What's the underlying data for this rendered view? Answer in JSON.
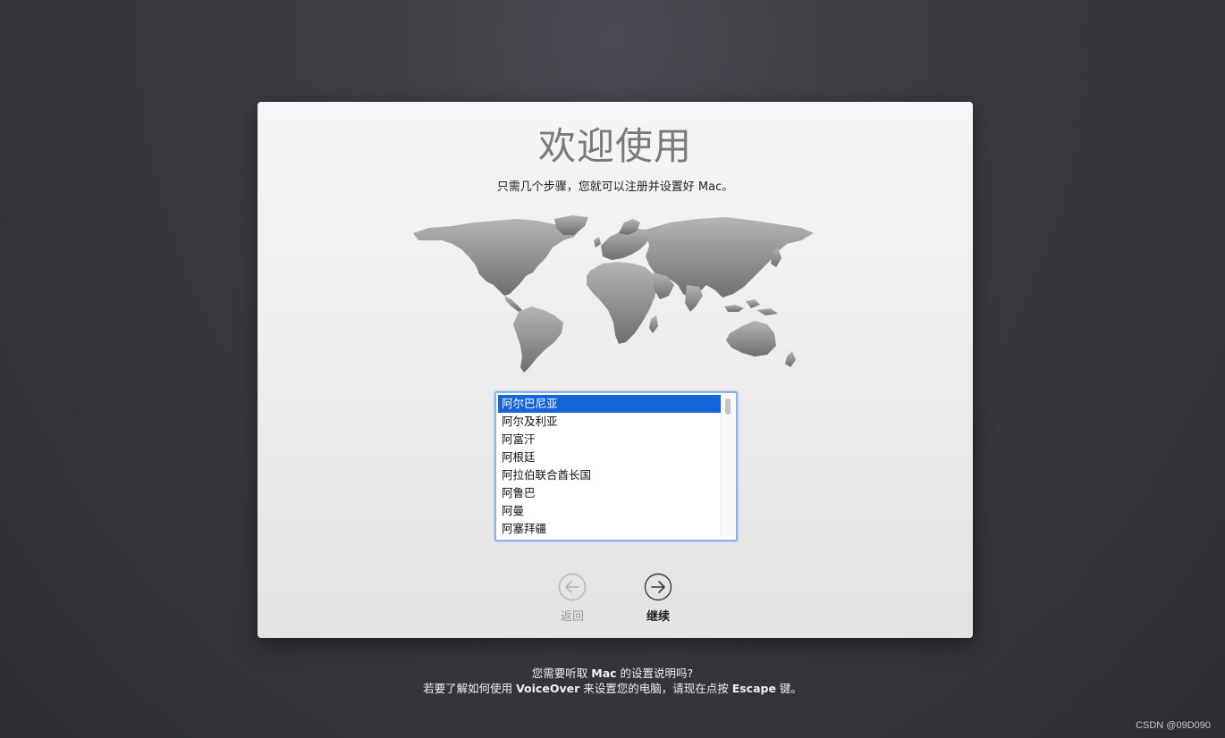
{
  "setup": {
    "title": "欢迎使用",
    "subtitle": "只需几个步骤，您就可以注册并设置好 Mac。",
    "countries": [
      "阿尔巴尼亚",
      "阿尔及利亚",
      "阿富汗",
      "阿根廷",
      "阿拉伯联合酋长国",
      "阿鲁巴",
      "阿曼",
      "阿塞拜疆"
    ],
    "selected_country": "阿尔巴尼亚",
    "back_label": "返回",
    "continue_label": "继续"
  },
  "voiceover": {
    "line1_pre": "您需要听取 ",
    "line1_bold": "Mac",
    "line1_post": " 的设置说明吗?",
    "line2_pre": "若要了解如何使用 ",
    "line2_bold1": "VoiceOver",
    "line2_mid": " 来设置您的电脑，请现在点按 ",
    "line2_bold2": "Escape",
    "line2_post": " 键。"
  },
  "watermark": "CSDN @09D090",
  "colors": {
    "selection": "#1565d8",
    "list_focus_ring": "#8cb4e6",
    "map_land": "#8a8a8a"
  },
  "icons": {
    "back": "arrow-left-circle-icon",
    "continue": "arrow-right-circle-icon",
    "map": "world-map-icon"
  }
}
